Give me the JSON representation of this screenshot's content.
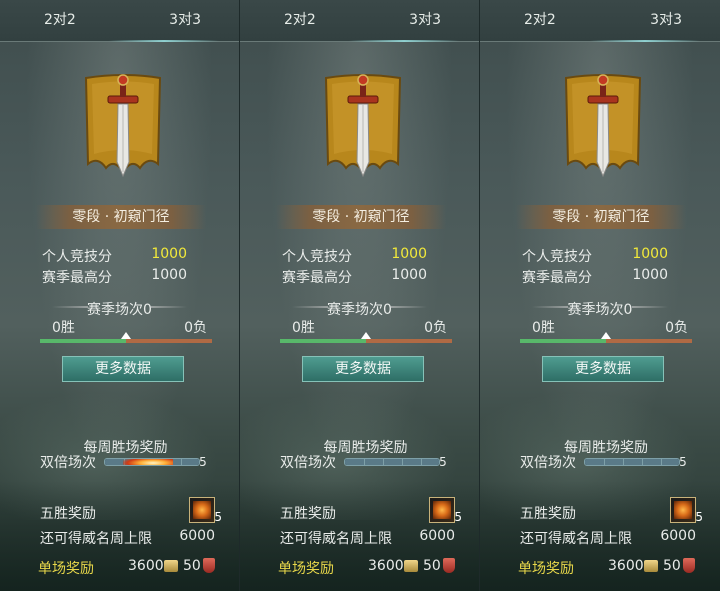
{
  "panels": [
    {
      "tabs": [
        "2对2",
        "3对3"
      ],
      "rank": "零段 · 初窥门径",
      "personal_score_label": "个人竞技分",
      "personal_score": "1000",
      "season_high_label": "赛季最高分",
      "season_high": "1000",
      "season_matches": "赛季场次0",
      "wins": "0胜",
      "losses": "0负",
      "win_ratio": 0.5,
      "more_button": "更多数据",
      "weekly_title": "每周胜场奖励",
      "double_label": "双倍场次",
      "double_count": "5",
      "five_wins_label": "五胜奖励",
      "five_wins_count": "5",
      "remain_label": "还可得威名周上限",
      "remain_value": "6000",
      "single_label": "单场奖励",
      "single_coin": "3600",
      "single_shield": "50",
      "fire_active": true
    },
    {
      "tabs": [
        "2对2",
        "3对3"
      ],
      "rank": "零段 · 初窥门径",
      "personal_score_label": "个人竞技分",
      "personal_score": "1000",
      "season_high_label": "赛季最高分",
      "season_high": "1000",
      "season_matches": "赛季场次0",
      "wins": "0胜",
      "losses": "0负",
      "win_ratio": 0.5,
      "more_button": "更多数据",
      "weekly_title": "每周胜场奖励",
      "double_label": "双倍场次",
      "double_count": "5",
      "five_wins_label": "五胜奖励",
      "five_wins_count": "5",
      "remain_label": "还可得威名周上限",
      "remain_value": "6000",
      "single_label": "单场奖励",
      "single_coin": "3600",
      "single_shield": "50",
      "fire_active": false
    },
    {
      "tabs": [
        "2对2",
        "3对3"
      ],
      "rank": "零段 · 初窥门径",
      "personal_score_label": "个人竞技分",
      "personal_score": "1000",
      "season_high_label": "赛季最高分",
      "season_high": "1000",
      "season_matches": "赛季场次0",
      "wins": "0胜",
      "losses": "0负",
      "win_ratio": 0.5,
      "more_button": "更多数据",
      "weekly_title": "每周胜场奖励",
      "double_label": "双倍场次",
      "double_count": "5",
      "five_wins_label": "五胜奖励",
      "five_wins_count": "5",
      "remain_label": "还可得威名周上限",
      "remain_value": "6000",
      "single_label": "单场奖励",
      "single_coin": "3600",
      "single_shield": "50",
      "fire_active": false
    }
  ],
  "colors": {
    "score_yellow": "#f2e93a",
    "single_reward_yellow": "#e8d84a",
    "win_green": "#58b86a",
    "loss_orange": "#b06a44",
    "button_teal": "#2e6e66",
    "banner_gold": "#b8871c"
  },
  "icons": {
    "emblem": "sword-banner-icon",
    "coin": "coin-icon",
    "shield": "shield-icon",
    "five_wins_item": "reward-chest-icon"
  }
}
